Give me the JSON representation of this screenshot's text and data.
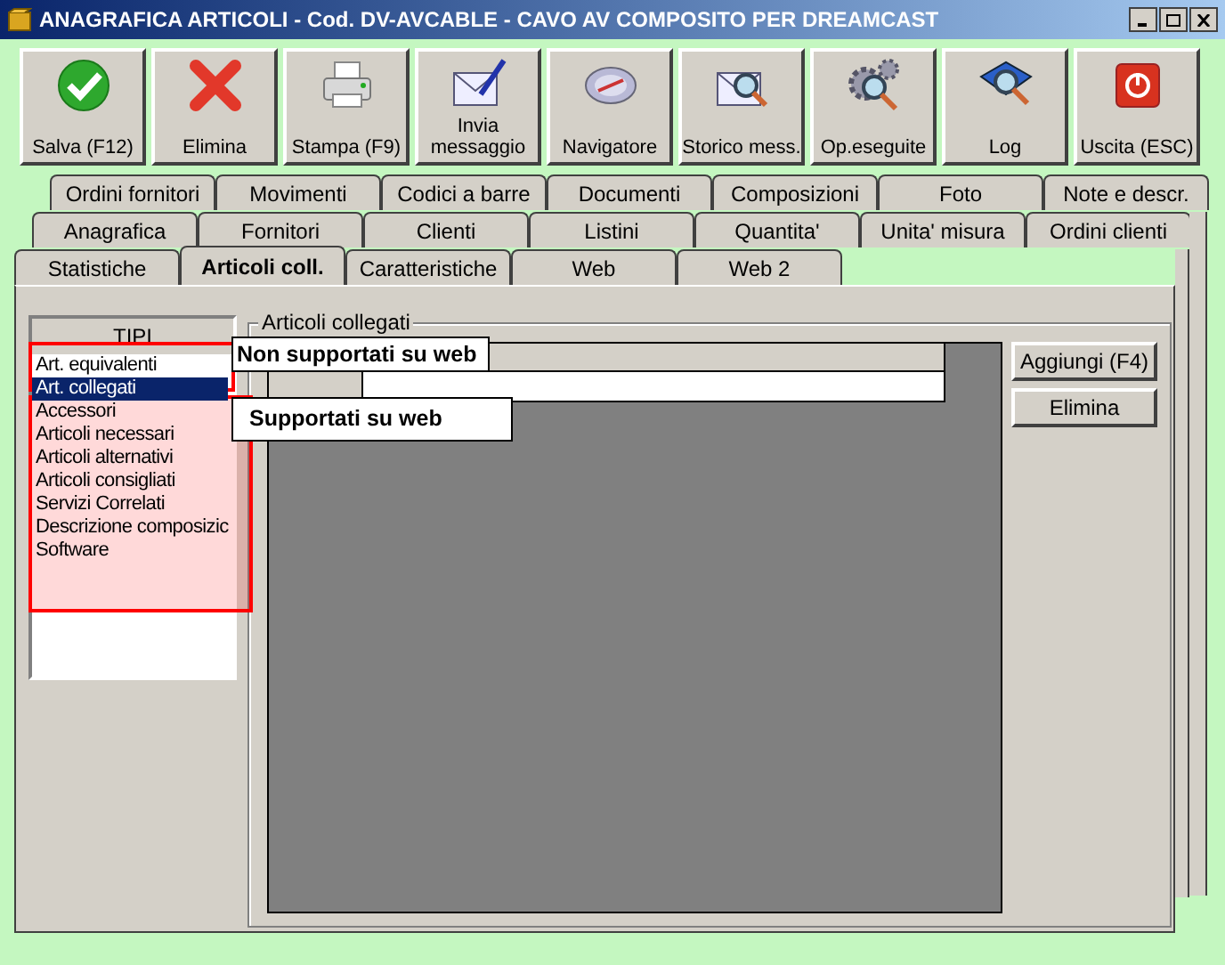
{
  "window": {
    "title": "ANAGRAFICA ARTICOLI - Cod. DV-AVCABLE - CAVO AV COMPOSITO PER DREAMCAST"
  },
  "toolbar": [
    {
      "label": "Salva (F12)",
      "kind": "check"
    },
    {
      "label": "Elimina",
      "kind": "cross"
    },
    {
      "label": "Stampa (F9)",
      "kind": "printer"
    },
    {
      "label": "Invia messaggio",
      "kind": "mail-pen"
    },
    {
      "label": "Navigatore",
      "kind": "compass"
    },
    {
      "label": "Storico mess.",
      "kind": "mail-search"
    },
    {
      "label": "Op.eseguite",
      "kind": "gear-search"
    },
    {
      "label": "Log",
      "kind": "book-search"
    },
    {
      "label": "Uscita (ESC)",
      "kind": "power"
    }
  ],
  "tab_rows": [
    [
      {
        "label": "Ordini fornitori",
        "selected": false
      },
      {
        "label": "Movimenti",
        "selected": false
      },
      {
        "label": "Codici a barre",
        "selected": false
      },
      {
        "label": "Documenti",
        "selected": false
      },
      {
        "label": "Composizioni",
        "selected": false
      },
      {
        "label": "Foto",
        "selected": false
      },
      {
        "label": "Note e descr.",
        "selected": false
      }
    ],
    [
      {
        "label": "Anagrafica",
        "selected": false
      },
      {
        "label": "Fornitori",
        "selected": false
      },
      {
        "label": "Clienti",
        "selected": false
      },
      {
        "label": "Listini",
        "selected": false
      },
      {
        "label": "Quantita'",
        "selected": false
      },
      {
        "label": "Unita' misura",
        "selected": false
      },
      {
        "label": "Ordini clienti",
        "selected": false
      }
    ],
    [
      {
        "label": "Statistiche",
        "selected": false
      },
      {
        "label": "Articoli coll.",
        "selected": true
      },
      {
        "label": "Caratteristiche",
        "selected": false
      },
      {
        "label": "Web",
        "selected": false
      },
      {
        "label": "Web 2",
        "selected": false
      }
    ]
  ],
  "tipi": {
    "header": "TIPI",
    "items": [
      {
        "label": "Art. equivalenti",
        "selected": false
      },
      {
        "label": "Art. collegati",
        "selected": true
      },
      {
        "label": "Accessori",
        "selected": false
      },
      {
        "label": "Articoli necessari",
        "selected": false
      },
      {
        "label": "Articoli alternativi",
        "selected": false
      },
      {
        "label": "Articoli consigliati",
        "selected": false
      },
      {
        "label": "Servizi Correlati",
        "selected": false
      },
      {
        "label": "Descrizione composizic",
        "selected": false
      },
      {
        "label": "Software",
        "selected": false
      }
    ]
  },
  "group": {
    "title": "Articoli collegati"
  },
  "buttons": [
    "Aggiungi (F4)",
    "Elimina"
  ],
  "annotations": [
    {
      "label": "Non supportati su web",
      "kind": "outline"
    },
    {
      "label": "Supportati su web",
      "kind": "highlight"
    }
  ]
}
